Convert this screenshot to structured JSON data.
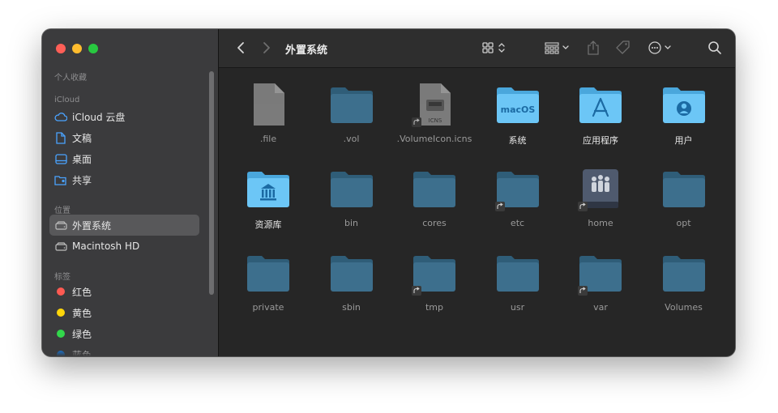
{
  "window": {
    "title": "外置系统"
  },
  "sidebar": {
    "sections": [
      {
        "label": "个人收藏"
      },
      {
        "label": "iCloud"
      },
      {
        "label": "位置"
      },
      {
        "label": "标签"
      }
    ],
    "icloud_items": [
      {
        "label": "iCloud 云盘",
        "icon": "cloud-icon"
      },
      {
        "label": "文稿",
        "icon": "document-icon"
      },
      {
        "label": "桌面",
        "icon": "desktop-icon"
      },
      {
        "label": "共享",
        "icon": "shared-folder-icon"
      }
    ],
    "location_items": [
      {
        "label": "外置系统",
        "icon": "drive-icon",
        "selected": true
      },
      {
        "label": "Macintosh HD",
        "icon": "drive-icon",
        "selected": false
      }
    ],
    "tags": [
      {
        "label": "红色",
        "color": "#ff5a52"
      },
      {
        "label": "黄色",
        "color": "#ffd60a"
      },
      {
        "label": "绿色",
        "color": "#32d74b"
      },
      {
        "label": "蓝色",
        "color": "#0a84ff"
      }
    ]
  },
  "toolbar": {
    "back": "back-icon",
    "forward": "forward-icon",
    "view": "icon-view-grid-icon",
    "group": "group-by-icon",
    "share": "share-icon",
    "tags": "tag-icon",
    "more": "more-actions-icon",
    "search": "search-icon"
  },
  "files": [
    {
      "name": ".file",
      "kind": "doc",
      "hidden": true
    },
    {
      "name": ".vol",
      "kind": "folder",
      "hidden": true
    },
    {
      "name": ".VolumeIcon.icns",
      "kind": "icns",
      "hidden": true,
      "alias": true
    },
    {
      "name": "系统",
      "kind": "folder-macos",
      "hidden": false,
      "badge": "macOS"
    },
    {
      "name": "应用程序",
      "kind": "folder-apps",
      "hidden": false
    },
    {
      "name": "用户",
      "kind": "folder-user",
      "hidden": false
    },
    {
      "name": "资源库",
      "kind": "folder-library",
      "hidden": false
    },
    {
      "name": "bin",
      "kind": "folder",
      "hidden": true
    },
    {
      "name": "cores",
      "kind": "folder",
      "hidden": true
    },
    {
      "name": "etc",
      "kind": "folder",
      "hidden": true,
      "alias": true
    },
    {
      "name": "home",
      "kind": "drive-home",
      "hidden": true,
      "alias": true
    },
    {
      "name": "opt",
      "kind": "folder",
      "hidden": true
    },
    {
      "name": "private",
      "kind": "folder",
      "hidden": true
    },
    {
      "name": "sbin",
      "kind": "folder",
      "hidden": true
    },
    {
      "name": "tmp",
      "kind": "folder",
      "hidden": true,
      "alias": true
    },
    {
      "name": "usr",
      "kind": "folder",
      "hidden": true
    },
    {
      "name": "var",
      "kind": "folder",
      "hidden": true,
      "alias": true
    },
    {
      "name": "Volumes",
      "kind": "folder",
      "hidden": true
    }
  ]
}
